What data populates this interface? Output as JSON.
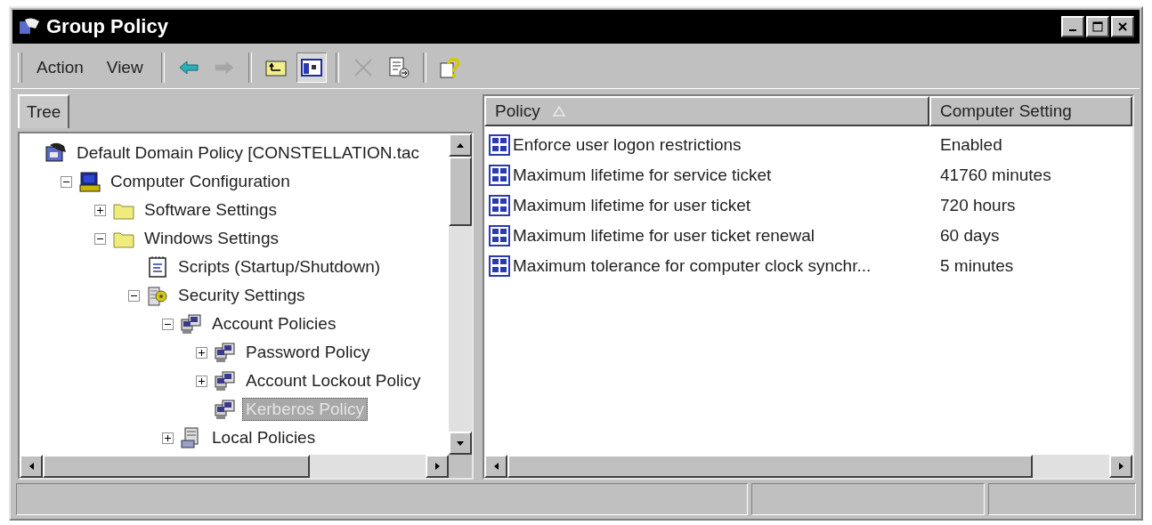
{
  "window": {
    "title": "Group Policy"
  },
  "menu": [
    {
      "label": "Action"
    },
    {
      "label": "View"
    }
  ],
  "toolbar": [
    {
      "kind": "back",
      "disabled": false,
      "pressed": false
    },
    {
      "kind": "forward",
      "disabled": true,
      "pressed": false
    },
    {
      "kind": "up",
      "disabled": false,
      "pressed": false
    },
    {
      "kind": "show-tree",
      "disabled": false,
      "pressed": true
    },
    {
      "kind": "delete",
      "disabled": true,
      "pressed": false
    },
    {
      "kind": "export",
      "disabled": false,
      "pressed": false
    },
    {
      "kind": "help",
      "disabled": false,
      "pressed": false
    }
  ],
  "tabs": [
    {
      "label": "Tree"
    }
  ],
  "tree": [
    {
      "label": "Default Domain Policy [CONSTELLATION.tac",
      "kind": "policy",
      "selected": false,
      "children": [
        {
          "label": "Computer Configuration",
          "kind": "computer",
          "expanded": true,
          "selected": false,
          "children": [
            {
              "label": "Software Settings",
              "kind": "folder",
              "expanded": false,
              "selected": false
            },
            {
              "label": "Windows Settings",
              "kind": "folder",
              "expanded": true,
              "selected": false,
              "children": [
                {
                  "label": "Scripts (Startup/Shutdown)",
                  "kind": "script",
                  "selected": false
                },
                {
                  "label": "Security Settings",
                  "kind": "security",
                  "expanded": true,
                  "selected": false,
                  "children": [
                    {
                      "label": "Account Policies",
                      "kind": "group",
                      "expanded": true,
                      "selected": false,
                      "children": [
                        {
                          "label": "Password Policy",
                          "kind": "group",
                          "expanded": false,
                          "selected": false
                        },
                        {
                          "label": "Account Lockout Policy",
                          "kind": "group",
                          "expanded": false,
                          "selected": false
                        },
                        {
                          "label": "Kerberos Policy",
                          "kind": "group",
                          "selected": true
                        }
                      ]
                    },
                    {
                      "label": "Local Policies",
                      "kind": "local",
                      "expanded": false,
                      "selected": false
                    }
                  ]
                }
              ]
            }
          ]
        }
      ]
    }
  ],
  "table": {
    "columns": [
      {
        "label": "Policy",
        "sorted": true
      },
      {
        "label": "Computer Setting",
        "sorted": false
      }
    ],
    "rows": [
      {
        "policy": "Enforce user logon restrictions",
        "setting": "Enabled"
      },
      {
        "policy": "Maximum lifetime for service ticket",
        "setting": "41760 minutes"
      },
      {
        "policy": "Maximum lifetime for user ticket",
        "setting": "720 hours"
      },
      {
        "policy": "Maximum lifetime for user ticket renewal",
        "setting": "60 days"
      },
      {
        "policy": "Maximum tolerance for computer clock synchr...",
        "setting": "5 minutes"
      }
    ]
  }
}
